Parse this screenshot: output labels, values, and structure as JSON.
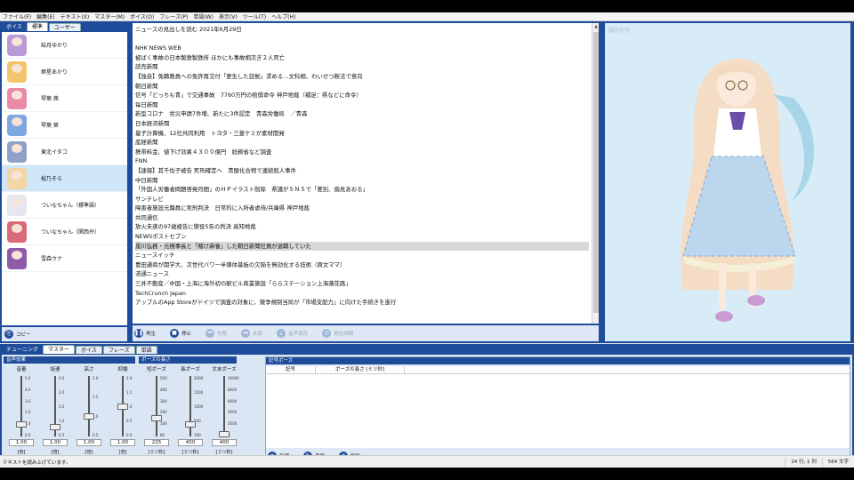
{
  "menu": [
    "ファイル(F)",
    "編集(E)",
    "テキスト(X)",
    "マスター(M)",
    "ボイス(O)",
    "フレーズ(P)",
    "単語(W)",
    "表示(V)",
    "ツール(T)",
    "ヘルプ(H)"
  ],
  "char_panel": {
    "tabs": [
      "ボイス",
      "標準",
      "ユーザー"
    ],
    "characters": [
      {
        "name": "結月ゆかり",
        "color": "#b79ad6"
      },
      {
        "name": "紲星あかり",
        "color": "#f2c46b"
      },
      {
        "name": "琴葉 茜",
        "color": "#e98aa6"
      },
      {
        "name": "琴葉 葵",
        "color": "#7da7e0"
      },
      {
        "name": "東北イタコ",
        "color": "#8ea2c8"
      },
      {
        "name": "桜乃そら",
        "color": "#f4d6a6",
        "selected": true
      },
      {
        "name": "ついなちゃん（標準語）",
        "color": "#e6e6ee"
      },
      {
        "name": "ついなちゃん（関西弁）",
        "color": "#d96a7a"
      },
      {
        "name": "雪森ウナ",
        "color": "#8f5aa8"
      }
    ],
    "copy_label": "コピー"
  },
  "text_panel": {
    "lines": [
      "ニュースの見出しを読む 2021年6月29日",
      "",
      "NHK NEWS WEB",
      "被ばく事故の日本製鉄製鉄所 ほかにも事故相次ぎ２人死亡",
      "読売新聞",
      "【独自】免職教員への免許再交付「更生した証拠」求める…文科相、わいせつ断法で意向",
      "朝日新聞",
      "信号「どっちも青」で交通事故　7760万円の賠償命令 神戸地裁（補足：県などに命令）",
      "毎日新聞",
      "新型コロナ　労災申請7件増、新たに3件認定　青森労働局　／青森",
      "日本経済新聞",
      "量子計算機、12社共同利用　トヨタ・三菱ケミが素材開発",
      "産経新聞",
      "携帯料金、値下げ効果４３００億円　総務省など調査",
      "FNN",
      "【速報】其千佐子被告 死刑確定へ　青酸化合物で連続殺人事件",
      "中日新聞",
      "「外国人労働者問題啓発月間」のＨＰイラスト削除　県議がＳＮＳで「差別、偏見あおる」",
      "サンテレビ",
      "障害者施設元職員に実刑判決　日常的に入所者虐待/兵庫県 神戸地裁",
      "共同通信",
      "放火未遂の97歳被告に懲役5年の判決 高知地裁",
      "NEWSポストセブン",
      "黒川弘務・元検事長と「賭け麻雀」した朝日新聞社員が退職していた",
      "ニュースイッチ",
      "豊田通商が関学大、次世代パワー半導体基板の欠陥を無効化する技術（原文ママ）",
      "流通ニュース",
      "三井不動産／中国・上海に海外初の駅ビル商業施設「ららステーション上海蓮花路」",
      "TechCrunch Japan",
      "アップルのApp Storeがドイツで調査の対象に、競争規制当局が「市場支配力」に向けた手続きを進行"
    ],
    "highlight_index": 23,
    "buttons": [
      {
        "label": "再生",
        "icon": "play-icon",
        "enabled": true
      },
      {
        "label": "停止",
        "icon": "stop-icon",
        "enabled": true
      },
      {
        "label": "先頭",
        "icon": "rewind-icon",
        "enabled": false
      },
      {
        "label": "末尾",
        "icon": "fast-forward-icon",
        "enabled": false
      },
      {
        "label": "音声保存",
        "icon": "save-audio-icon",
        "enabled": false
      },
      {
        "label": "再生時間",
        "icon": "clock-icon",
        "enabled": false
      }
    ]
  },
  "portrait": {
    "name": "桜乃そら"
  },
  "tune": {
    "tabs": [
      "チューニング",
      "マスター",
      "ボイス",
      "フレーズ",
      "単語"
    ],
    "voice_effect_title": "音声効果",
    "pause_title": "ポーズの長さ",
    "sliders": [
      {
        "label": "音量",
        "value": "1.00",
        "unit": "[倍]",
        "ticks": [
          "5.0",
          "4.0",
          "3.0",
          "2.0",
          "1.0",
          "0.0"
        ],
        "level": 0.2
      },
      {
        "label": "話速",
        "value": "1.00",
        "unit": "[倍]",
        "ticks": [
          "4.0",
          "3.0",
          "2.0",
          "1.0",
          "0.5"
        ],
        "level": 0.15
      },
      {
        "label": "高さ",
        "value": "1.00",
        "unit": "[倍]",
        "ticks": [
          "2.0",
          "1.5",
          "1.0",
          "0.5"
        ],
        "level": 0.33
      },
      {
        "label": "抑揚",
        "value": "1.00",
        "unit": "[倍]",
        "ticks": [
          "2.0",
          "1.5",
          "1.0",
          "0.5",
          "0.0"
        ],
        "level": 0.5
      },
      {
        "label": "短ポーズ",
        "value": "225",
        "unit": "[ミリ秒]",
        "ticks": [
          "500",
          "400",
          "300",
          "200",
          "100",
          "80"
        ],
        "level": 0.3
      },
      {
        "label": "長ポーズ",
        "value": "400",
        "unit": "[ミリ秒]",
        "ticks": [
          "2000",
          "1500",
          "1000",
          "500",
          "100"
        ],
        "level": 0.2
      },
      {
        "label": "文末ポーズ",
        "value": "400",
        "unit": "[ミリ秒]",
        "ticks": [
          "10000",
          "8000",
          "6000",
          "4000",
          "2000",
          "0"
        ],
        "level": 0.04
      }
    ],
    "symbol_title": "記号ポーズ",
    "symbol_headers": [
      "記号",
      "ポーズの長さ [ミリ秒]"
    ],
    "symbol_buttons": [
      {
        "label": "新規",
        "icon": "new-icon"
      },
      {
        "label": "変更",
        "icon": "edit-icon"
      },
      {
        "label": "削除",
        "icon": "delete-icon"
      }
    ]
  },
  "status": {
    "message": "テキストを読み上げています。",
    "position": "24 行, 1 列",
    "chars": "564 文字"
  }
}
